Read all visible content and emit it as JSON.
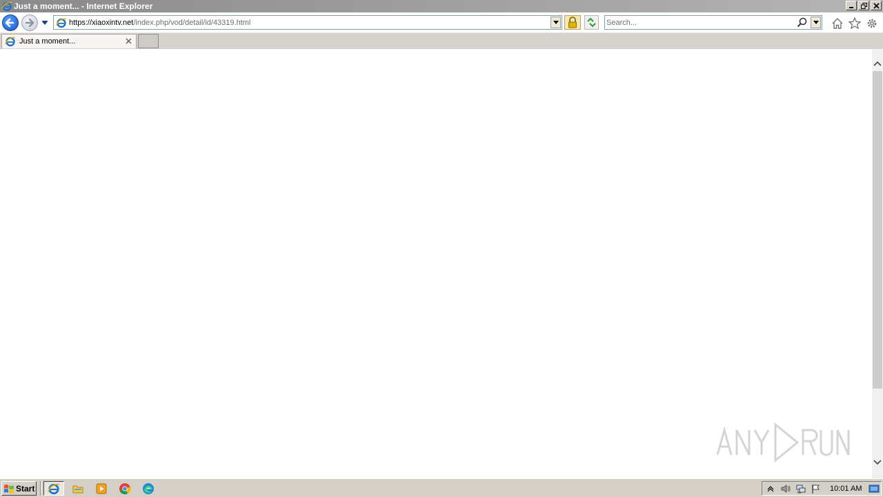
{
  "window": {
    "title": "Just a moment... - Internet Explorer",
    "buttons": {
      "minimize": "minimize",
      "restore": "restore",
      "close": "close"
    }
  },
  "navbar": {
    "url_host": "https://xiaoxintv.net",
    "url_path": "/index.php/vod/detail/id/43319.html",
    "search_placeholder": "Search..."
  },
  "tabs": [
    {
      "title": "Just a moment...",
      "active": true
    }
  ],
  "taskbar": {
    "start_label": "Start",
    "pinned": [
      "internet-explorer",
      "file-explorer",
      "media-player",
      "chrome",
      "edge"
    ],
    "clock": "10:01 AM"
  },
  "colors": {
    "titlebar": "#9a9a9a",
    "taskbar": "#d4d0c8",
    "tabbar": "#d6d3ce",
    "accent": "#1a55c4"
  }
}
